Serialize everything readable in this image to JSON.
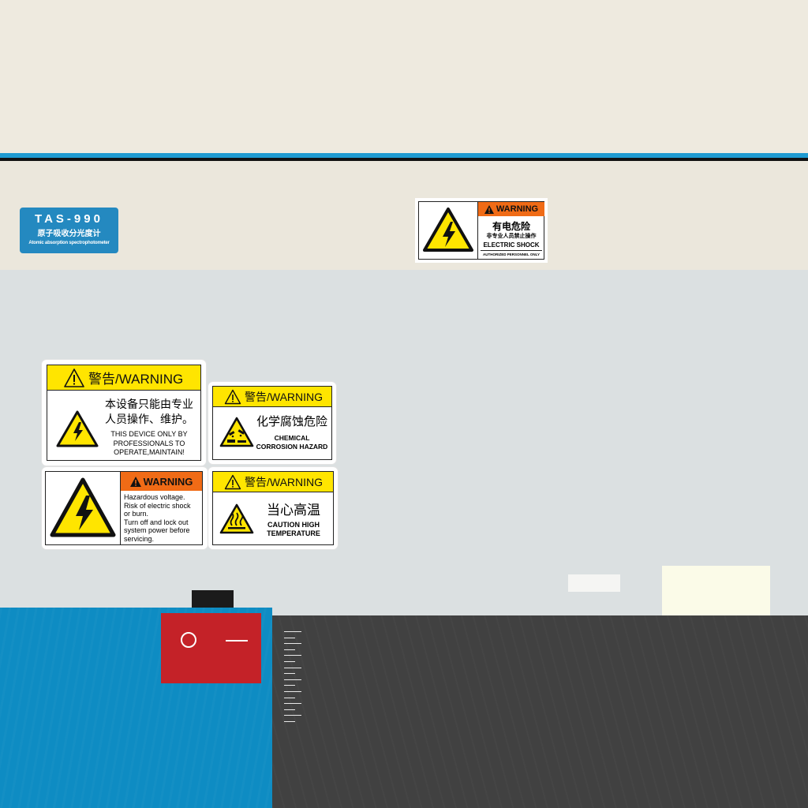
{
  "badge": {
    "model": "TAS-990",
    "name_cn": "原子吸收分光度计",
    "name_en": "Atomic absorption spectrophotometer"
  },
  "labels": {
    "electric_shock": {
      "header": "WARNING",
      "title_cn": "有电危险",
      "subtitle_cn": "非专业人员禁止操作",
      "title_en": "ELECTRIC SHOCK",
      "subtitle_en": "AUTHORIZED PERSONNEL ONLY"
    },
    "professionals": {
      "header": "警告/WARNING",
      "text_cn_1": "本设备只能由专业",
      "text_cn_2": "人员操作、维护。",
      "text_en_1": "THIS DEVICE ONLY BY",
      "text_en_2": "PROFESSIONALS TO",
      "text_en_3": "OPERATE,MAINTAIN!"
    },
    "chemical": {
      "header": "警告/WARNING",
      "text_cn": "化学腐蚀危险",
      "text_en_1": "CHEMICAL",
      "text_en_2": "CORROSION HAZARD"
    },
    "voltage": {
      "header": "WARNING",
      "line_1": "Hazardous voltage.",
      "line_2": "Risk of electric shock",
      "line_3": "or burn.",
      "line_4": "Turn off and lock out",
      "line_5": "system power before",
      "line_6": "servicing."
    },
    "temperature": {
      "header": "警告/WARNING",
      "text_cn": "当心高温",
      "text_en_1": "CAUTION HIGH",
      "text_en_2": "TEMPERATURE"
    }
  },
  "colors": {
    "warning_yellow": "#ffe500",
    "warning_orange": "#f06b16",
    "brand_blue": "#2489c0",
    "base_blue": "#0e8cc3",
    "power_red": "#c42228",
    "body_gray": "#dbe0e1",
    "panel_beige": "#eeeadf",
    "base_dark": "#414141"
  },
  "icons": {
    "electric": "high-voltage-warning-icon",
    "caution": "exclamation-triangle-icon",
    "corrosion": "corrosion-warning-icon",
    "heat": "hot-surface-warning-icon",
    "power_off": "power-off-circle-icon",
    "power_on": "power-on-line-icon"
  }
}
